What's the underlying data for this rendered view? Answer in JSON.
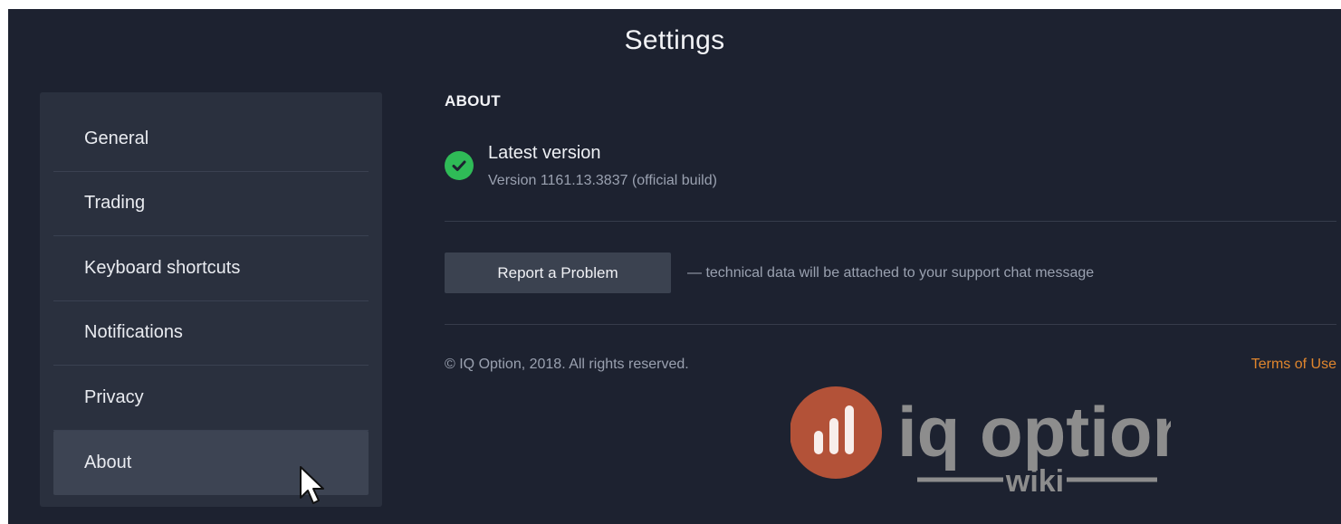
{
  "window": {
    "title": "Settings"
  },
  "sidebar": {
    "items": [
      {
        "label": "General"
      },
      {
        "label": "Trading"
      },
      {
        "label": "Keyboard shortcuts"
      },
      {
        "label": "Notifications"
      },
      {
        "label": "Privacy"
      },
      {
        "label": "About"
      }
    ],
    "active_item": "About"
  },
  "about": {
    "heading": "ABOUT",
    "version_status": "Latest version",
    "version_detail": "Version 1161.13.3837 (official build)",
    "status_icon": "check-circle-icon",
    "report_button_label": "Report a Problem",
    "report_note": "— technical data will be attached to your support chat message",
    "copyright": "© IQ Option, 2018. All rights reserved.",
    "terms_link": "Terms of Use"
  },
  "watermark": {
    "brand": "iq option",
    "sub": "wiki",
    "icon": "bar-chart-icon"
  },
  "colors": {
    "background": "#1d2230",
    "sidebar": "#2a303e",
    "active_item": "#3d4453",
    "accent_orange": "#e0862d",
    "success_green": "#2fbb57",
    "logo_circle": "#c0573a",
    "logo_text": "#8d8d8d"
  }
}
